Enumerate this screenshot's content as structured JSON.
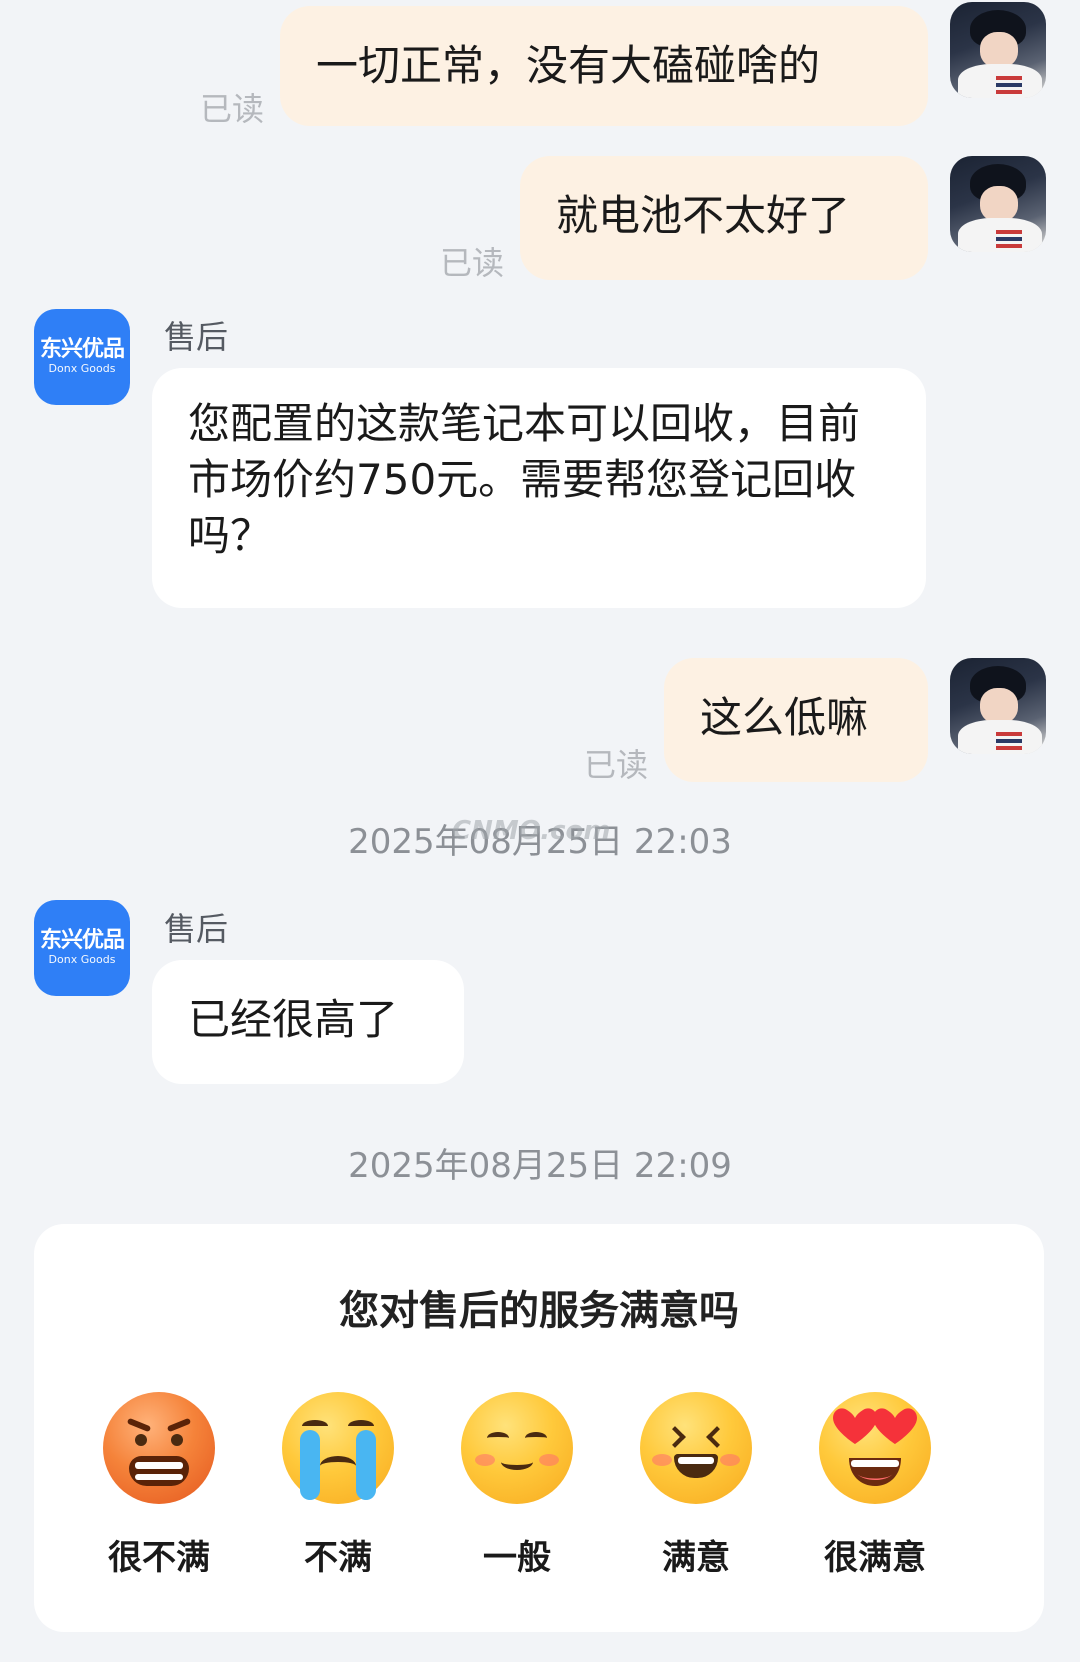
{
  "messages": [
    {
      "side": "me",
      "text": "一切正常，没有大磕碰啥的",
      "status": "已读"
    },
    {
      "side": "me",
      "text": "就电池不太好了",
      "status": "已读"
    },
    {
      "side": "service",
      "sender": "售后",
      "text": "您配置的这款笔记本可以回收，目前市场价约750元。需要帮您登记回收吗？"
    },
    {
      "side": "me",
      "text": "这么低嘛",
      "status": "已读"
    },
    {
      "side": "service",
      "sender": "售后",
      "text": "已经很高了"
    }
  ],
  "timestamps": [
    "2025年08月25日 22:03",
    "2025年08月25日 22:09"
  ],
  "watermark": "CNMO.com",
  "service_avatar": {
    "brand": "东兴优品",
    "brand_sub": "Donx Goods",
    "color": "#2f7ff6"
  },
  "survey": {
    "title": "您对售后的服务满意吗",
    "options": [
      {
        "label": "很不满",
        "icon": "angry-face-icon"
      },
      {
        "label": "不满",
        "icon": "crying-face-icon"
      },
      {
        "label": "一般",
        "icon": "smiling-face-icon"
      },
      {
        "label": "满意",
        "icon": "grinning-squint-face-icon"
      },
      {
        "label": "很满意",
        "icon": "heart-eyes-face-icon"
      }
    ]
  },
  "colors": {
    "my_bubble": "#fdf1e3",
    "service_bubble": "#ffffff",
    "background": "#f2f4f7"
  }
}
